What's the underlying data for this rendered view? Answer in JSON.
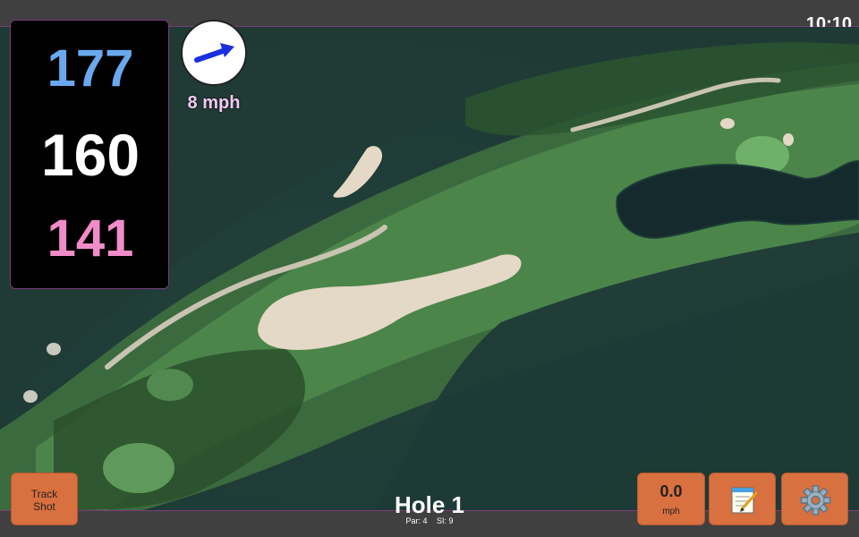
{
  "status": {
    "time": "10:10"
  },
  "yardages": {
    "back": "177",
    "middle": "160",
    "front": "141"
  },
  "wind": {
    "speed_label": "8 mph",
    "icon": "wind-arrow-icon"
  },
  "hole": {
    "title": "Hole 1",
    "par_label": "Par: 4",
    "si_label": "SI: 9"
  },
  "buttons": {
    "track_shot": "Track Shot",
    "speed_value": "0.0",
    "speed_unit": "mph",
    "notes_icon": "notepad-icon",
    "settings_icon": "gear-icon"
  },
  "colors": {
    "back": "#6aa9ee",
    "middle": "#ffffff",
    "front": "#f08cc8",
    "button": "#d9703f",
    "accent": "#7a3a7a"
  }
}
